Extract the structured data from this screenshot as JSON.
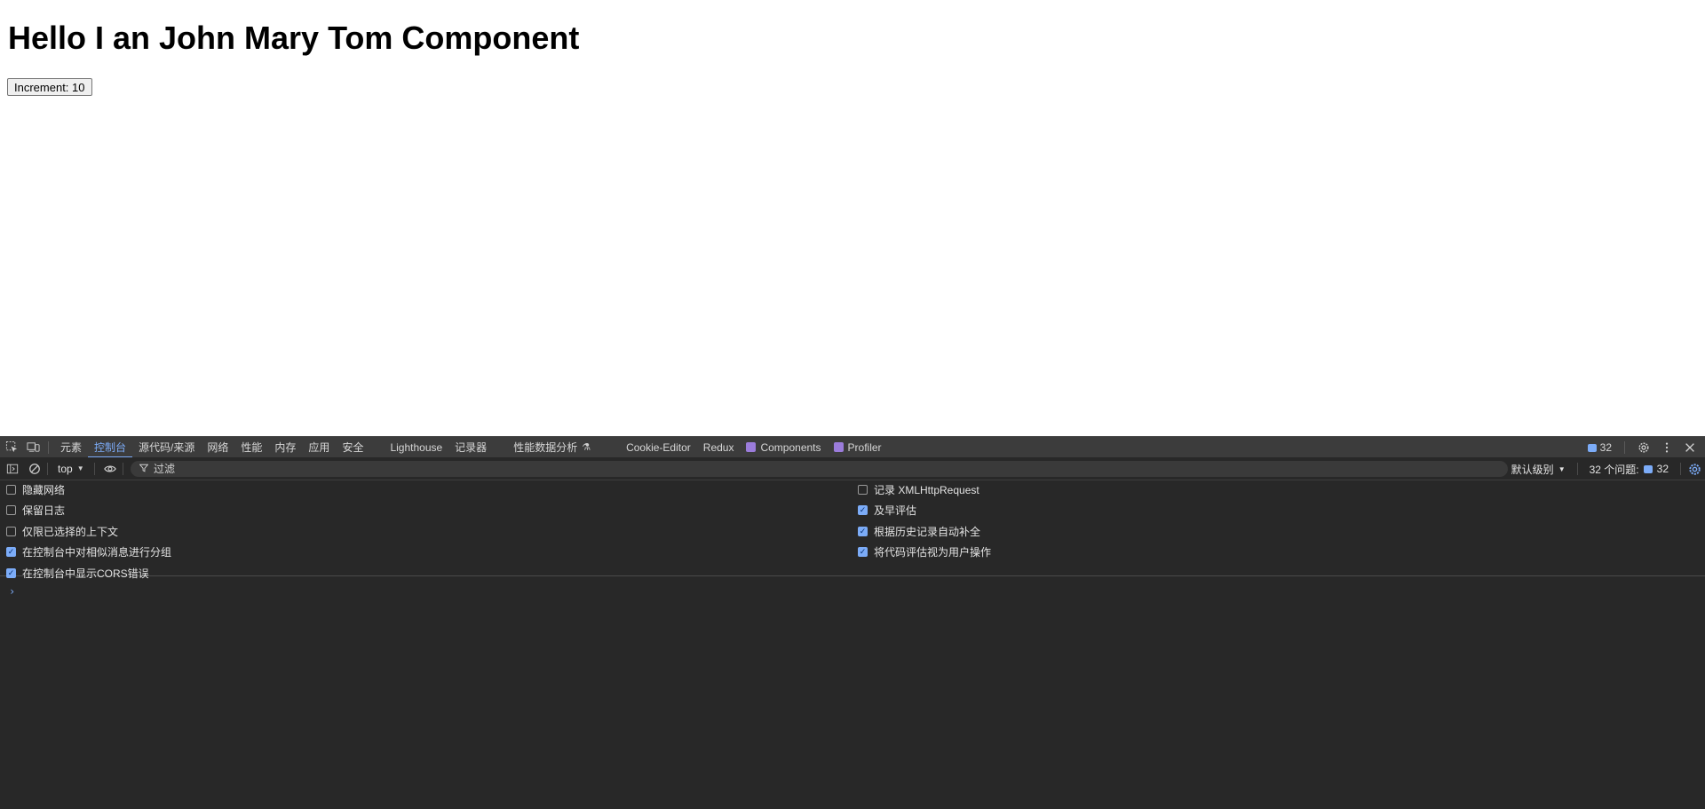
{
  "page": {
    "heading": "Hello I an John Mary Tom Component",
    "increment_button": "Increment: 10"
  },
  "devtools": {
    "tabs": [
      {
        "label": "元素",
        "active": false
      },
      {
        "label": "控制台",
        "active": true
      },
      {
        "label": "源代码/来源",
        "active": false
      },
      {
        "label": "网络",
        "active": false
      },
      {
        "label": "性能",
        "active": false
      },
      {
        "label": "内存",
        "active": false
      },
      {
        "label": "应用",
        "active": false
      },
      {
        "label": "安全",
        "active": false
      },
      {
        "label": "Lighthouse",
        "active": false
      },
      {
        "label": "记录器",
        "active": false
      },
      {
        "label": "性能数据分析",
        "active": false
      },
      {
        "label": "Cookie-Editor",
        "active": false
      },
      {
        "label": "Redux",
        "active": false
      },
      {
        "label": "Components",
        "active": false
      },
      {
        "label": "Profiler",
        "active": false
      }
    ],
    "issues_badge": "32",
    "toolbar": {
      "context": "top",
      "filter_placeholder": "过滤",
      "level": "默认级别",
      "issues_label": "32 个问题:",
      "issues_count": "32"
    },
    "settings_left": [
      {
        "label": "隐藏网络",
        "checked": false
      },
      {
        "label": "保留日志",
        "checked": false
      },
      {
        "label": "仅限已选择的上下文",
        "checked": false
      },
      {
        "label": "在控制台中对相似消息进行分组",
        "checked": true
      },
      {
        "label": "在控制台中显示CORS错误",
        "checked": true
      }
    ],
    "settings_right": [
      {
        "label": "记录 XMLHttpRequest",
        "checked": false
      },
      {
        "label": "及早评估",
        "checked": true
      },
      {
        "label": "根据历史记录自动补全",
        "checked": true
      },
      {
        "label": "将代码评估视为用户操作",
        "checked": true
      }
    ],
    "prompt_symbol": "›",
    "colors": {
      "accent": "#7cacf8",
      "panel_bg": "#282828",
      "tabbar_bg": "#3c3c3c",
      "react_icon": "#9b7cdb"
    }
  }
}
